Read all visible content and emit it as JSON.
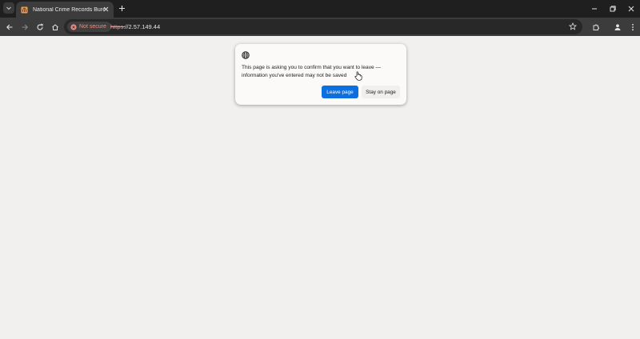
{
  "browser": {
    "tab": {
      "title": "National Crime Records Bureau",
      "favicon": "building-icon"
    },
    "address_bar": {
      "security_label": "Not secure",
      "url_scheme": "https:",
      "url_rest": "//2.57.149.44"
    },
    "colors": {
      "frame": "#1f1f1f",
      "toolbar": "#3c3c3c",
      "not_secure": "#f28b82"
    }
  },
  "dialog": {
    "icon": "globe-icon",
    "message": "This page is asking you to confirm that you want to leave — information you've entered may not be saved",
    "leave_label": "Leave page",
    "stay_label": "Stay on page",
    "primary_color": "#0b6fe0"
  },
  "page": {
    "background": "#f1f0ee"
  }
}
